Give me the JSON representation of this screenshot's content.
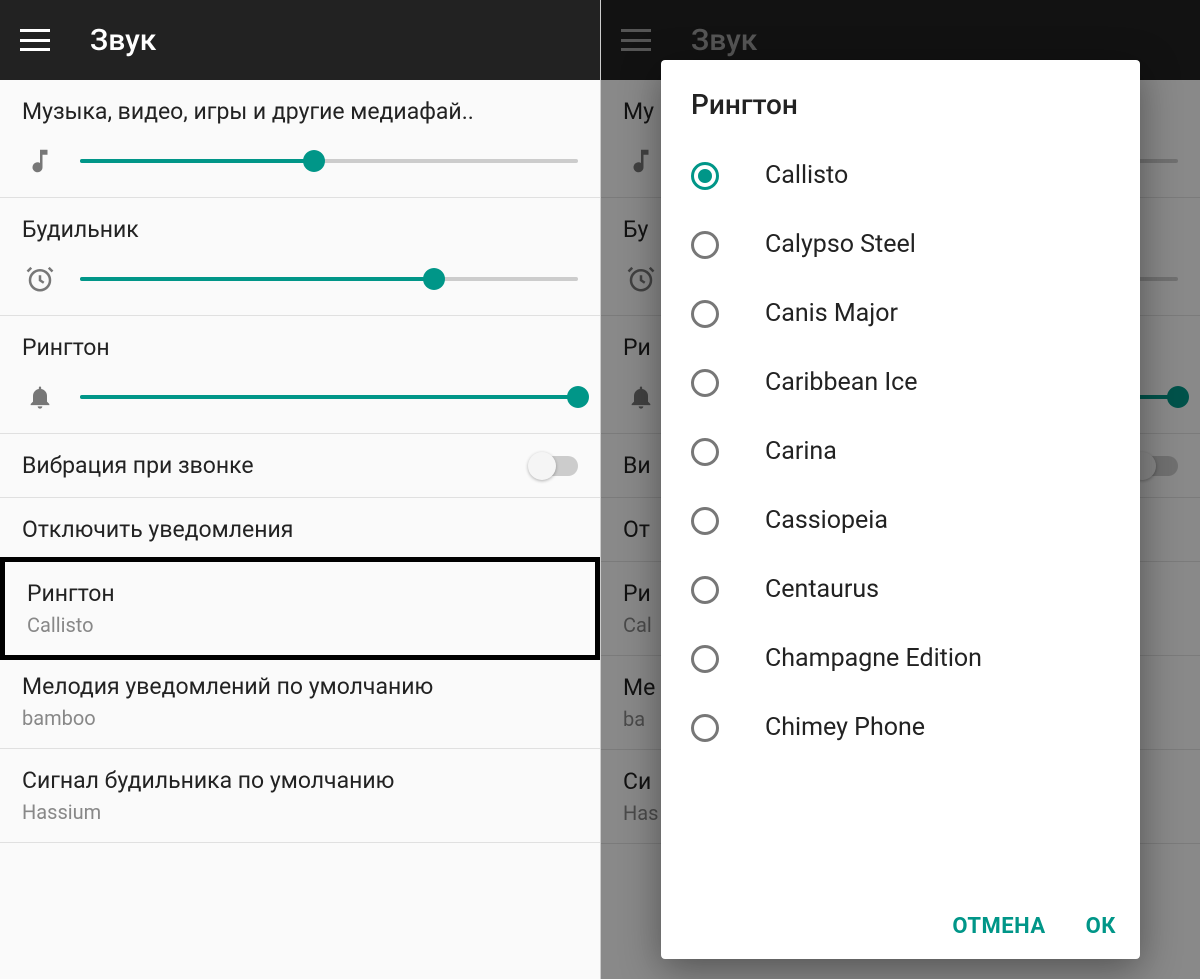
{
  "colors": {
    "accent": "#009688"
  },
  "left": {
    "appbar": {
      "title": "Звук"
    },
    "sliders": {
      "media": {
        "label": "Музыка, видео, игры и другие медиафай..",
        "valuePct": 47,
        "icon": "music-note-icon"
      },
      "alarm": {
        "label": "Будильник",
        "valuePct": 71,
        "icon": "alarm-clock-icon"
      },
      "ringtone": {
        "label": "Рингтон",
        "valuePct": 100,
        "icon": "bell-icon"
      }
    },
    "toggles": {
      "vibrate": {
        "label": "Вибрация при звонке",
        "on": false
      }
    },
    "items": {
      "dnd": {
        "label": "Отключить уведомления"
      },
      "ringtone": {
        "label": "Рингтон",
        "value": "Callisto"
      },
      "notification": {
        "label": "Мелодия уведомлений по умолчанию",
        "value": "bamboo"
      },
      "alarm": {
        "label": "Сигнал будильника по умолчанию",
        "value": "Hassium"
      }
    }
  },
  "right": {
    "appbar": {
      "title": "Звук"
    },
    "bg": {
      "dnd": "От",
      "rt_label": "Ри",
      "rt_val": "Cal",
      "notif_label": "Ме",
      "notif_val": "ba",
      "alarm_label": "Си",
      "alarm_val": "Has",
      "media": "Му",
      "alarm_s": "Бу",
      "ringtone_s": "Ри",
      "vibrate": "Ви"
    },
    "dialog": {
      "title": "Рингтон",
      "options": [
        {
          "label": "Callisto",
          "selected": true
        },
        {
          "label": "Calypso Steel",
          "selected": false
        },
        {
          "label": "Canis Major",
          "selected": false
        },
        {
          "label": "Caribbean Ice",
          "selected": false
        },
        {
          "label": "Carina",
          "selected": false
        },
        {
          "label": "Cassiopeia",
          "selected": false
        },
        {
          "label": "Centaurus",
          "selected": false
        },
        {
          "label": "Champagne Edition",
          "selected": false
        },
        {
          "label": "Chimey Phone",
          "selected": false
        }
      ],
      "cancel": "ОТМЕНА",
      "ok": "ОК"
    }
  }
}
